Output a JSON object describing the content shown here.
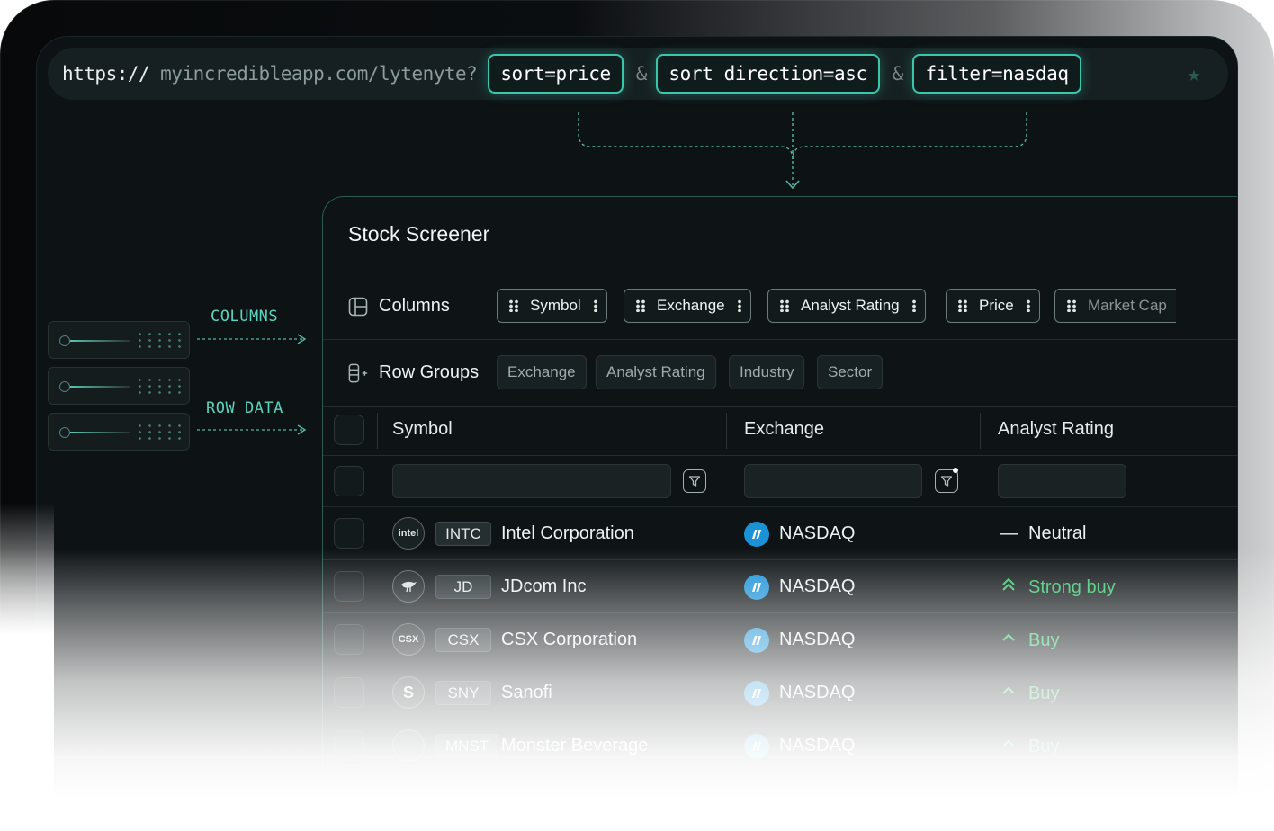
{
  "url": {
    "protocol": "https://",
    "host_path": "myincredibleapp.com/lytenyte?",
    "params": [
      "sort=price",
      "sort direction=asc",
      "filter=nasdaq"
    ],
    "separator": "&"
  },
  "side": {
    "columns_label": "COLUMNS",
    "row_data_label": "ROW DATA"
  },
  "grid": {
    "title": "Stock Screener",
    "columns_label": "Columns",
    "column_chips": [
      "Symbol",
      "Exchange",
      "Analyst Rating",
      "Price",
      "Market Cap"
    ],
    "row_groups_label": "Row Groups",
    "group_chips": [
      "Exchange",
      "Analyst Rating",
      "Industry",
      "Sector"
    ],
    "headers": [
      "Symbol",
      "Exchange",
      "Analyst Rating"
    ],
    "rows": [
      {
        "logo": "intel",
        "ticker": "INTC",
        "name": "Intel Corporation",
        "exchange": "NASDAQ",
        "rating": "Neutral",
        "rating_icon": "dash-icon",
        "rating_color": "#eef2f2"
      },
      {
        "logo": "",
        "ticker": "JD",
        "name": "JDcom Inc",
        "exchange": "NASDAQ",
        "rating": "Strong buy",
        "rating_icon": "double-chevron-up-icon",
        "rating_color": "#36c46a"
      },
      {
        "logo": "CSX",
        "ticker": "CSX",
        "name": "CSX Corporation",
        "exchange": "NASDAQ",
        "rating": "Buy",
        "rating_icon": "chevron-up-icon",
        "rating_color": "#36c46a"
      },
      {
        "logo": "S",
        "ticker": "SNY",
        "name": "Sanofi",
        "exchange": "NASDAQ",
        "rating": "Buy",
        "rating_icon": "chevron-up-icon",
        "rating_color": "#36c46a"
      },
      {
        "logo": "",
        "ticker": "MNST",
        "name": "Monster Beverage",
        "exchange": "NASDAQ",
        "rating": "Buy",
        "rating_icon": "chevron-up-icon",
        "rating_color": "#36c46a"
      }
    ]
  },
  "colors": {
    "accent": "#39c6ad",
    "background": "#0d1214",
    "positive": "#36c46a",
    "exchange_logo": "#1b92d6"
  }
}
